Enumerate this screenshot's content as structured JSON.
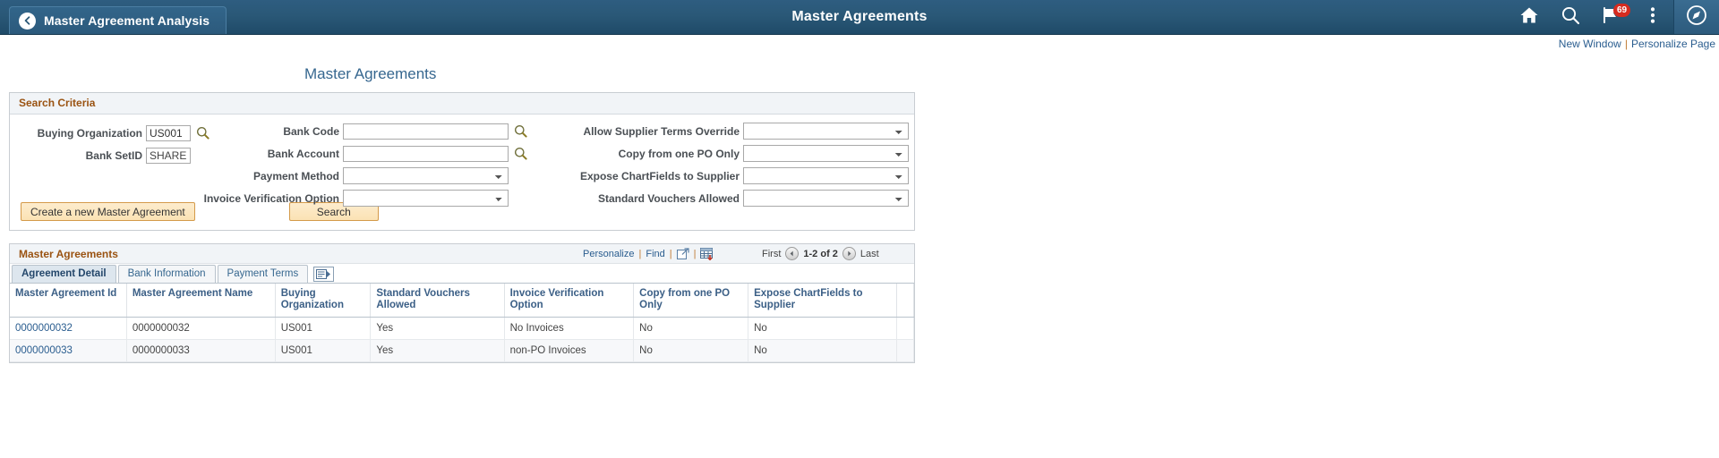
{
  "header": {
    "back_tab_label": "Master Agreement Analysis",
    "title": "Master Agreements",
    "icons": {
      "home": "home-icon",
      "search": "search-icon",
      "notifications": "flag-icon",
      "notification_count": "69",
      "actions": "three-dots-icon",
      "navbar": "navbar-compass-icon"
    }
  },
  "page_links": {
    "new_window": "New Window",
    "separator": "|",
    "personalize_page": "Personalize Page"
  },
  "page": {
    "heading": "Master Agreements"
  },
  "search_criteria": {
    "title": "Search Criteria",
    "fields": {
      "buying_organization": {
        "label": "Buying Organization",
        "value": "US001"
      },
      "bank_setid": {
        "label": "Bank SetID",
        "value": "SHARE"
      },
      "bank_code": {
        "label": "Bank Code",
        "value": ""
      },
      "bank_account": {
        "label": "Bank Account",
        "value": ""
      },
      "payment_method": {
        "label": "Payment Method",
        "value": ""
      },
      "invoice_verification_option": {
        "label": "Invoice Verification Option",
        "value": ""
      },
      "allow_supplier_terms_override": {
        "label": "Allow Supplier Terms Override",
        "value": ""
      },
      "copy_from_one_po_only": {
        "label": "Copy from one PO Only",
        "value": ""
      },
      "expose_chartfields_to_supplier": {
        "label": "Expose ChartFields to Supplier",
        "value": ""
      },
      "standard_vouchers_allowed": {
        "label": "Standard Vouchers Allowed",
        "value": ""
      }
    },
    "buttons": {
      "create": "Create a new Master Agreement",
      "search": "Search"
    }
  },
  "grid": {
    "title": "Master Agreements",
    "tools": {
      "personalize": "Personalize",
      "find": "Find",
      "export_icon": "new-window-icon",
      "download_icon": "download-spreadsheet-icon"
    },
    "nav": {
      "first": "First",
      "prev_icon": "prev-arrow-icon",
      "range": "1-2 of 2",
      "next_icon": "next-arrow-icon",
      "last": "Last"
    },
    "tabs": [
      {
        "label": "Agreement Detail",
        "active": true
      },
      {
        "label": "Bank Information",
        "active": false
      },
      {
        "label": "Payment Terms",
        "active": false
      }
    ],
    "tab_icon": "show-all-columns-icon",
    "columns": [
      "Master Agreement Id",
      "Master Agreement Name",
      "Buying Organization",
      "Standard Vouchers Allowed",
      "Invoice Verification Option",
      "Copy from one PO Only",
      "Expose ChartFields to Supplier",
      ""
    ],
    "rows": [
      {
        "id": "0000000032",
        "name": "0000000032",
        "buying_org": "US001",
        "std_vouchers": "Yes",
        "invoice_verification": "No Invoices",
        "copy_from_po": "No",
        "expose_chartfields": "No",
        "extra": ""
      },
      {
        "id": "0000000033",
        "name": "0000000033",
        "buying_org": "US001",
        "std_vouchers": "Yes",
        "invoice_verification": "non-PO Invoices",
        "copy_from_po": "No",
        "expose_chartfields": "No",
        "extra": ""
      }
    ]
  },
  "colors": {
    "header_blue": "#2a5877",
    "link_blue": "#2a5d8f",
    "section_orange": "#9a5312",
    "badge_red": "#d62b1f",
    "button_tan": "#fbe2b4"
  }
}
